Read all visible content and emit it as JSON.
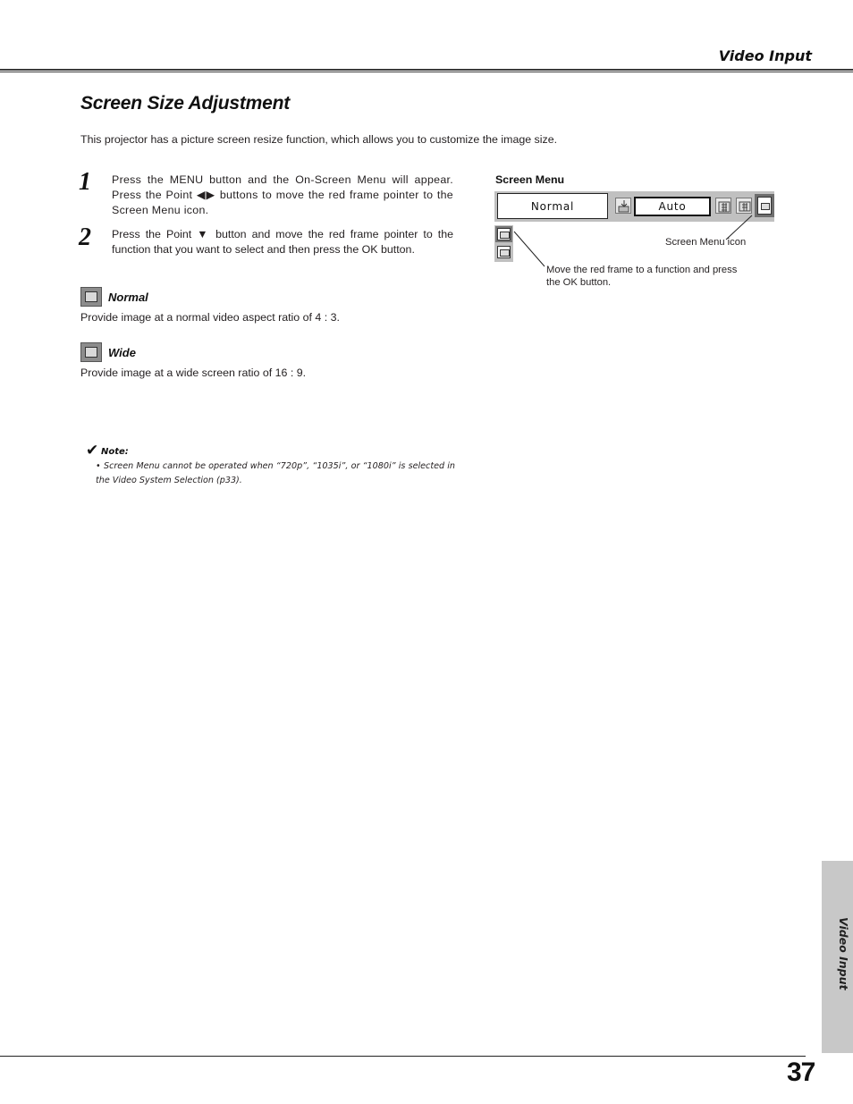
{
  "header": {
    "section": "Video Input"
  },
  "title": "Screen Size Adjustment",
  "intro": "This projector has a picture screen resize function, which allows you to customize the image size.",
  "steps": [
    {
      "number": "1",
      "text": "Press the MENU button and the On-Screen Menu will appear.  Press the Point ◀▶ buttons to move the red frame pointer to the Screen Menu icon."
    },
    {
      "number": "2",
      "text": "Press the Point ▼ button and move the red frame pointer to the function that you want to select and then press the OK button."
    }
  ],
  "options": [
    {
      "icon": "normal-screen-icon",
      "label": "Normal",
      "description": "Provide image at a normal video aspect ratio of 4 : 3."
    },
    {
      "icon": "wide-screen-icon",
      "label": "Wide",
      "description": "Provide image at a wide screen ratio of 16 : 9."
    }
  ],
  "note": {
    "icon": "checkmark-icon",
    "check": "✔",
    "label": "Note:",
    "bullet": "•",
    "text": "Screen Menu cannot be operated when “720p”, “1035i”, or “1080i” is selected in the Video System Selection  (p33)."
  },
  "figure": {
    "title": "Screen Menu",
    "menu_value": "Normal",
    "auto_label": "Auto",
    "callout_icon": "Screen Menu icon",
    "callout_frame": "Move the red frame to a function and press the OK button."
  },
  "side_tab": "Video Input",
  "page_number": "37"
}
